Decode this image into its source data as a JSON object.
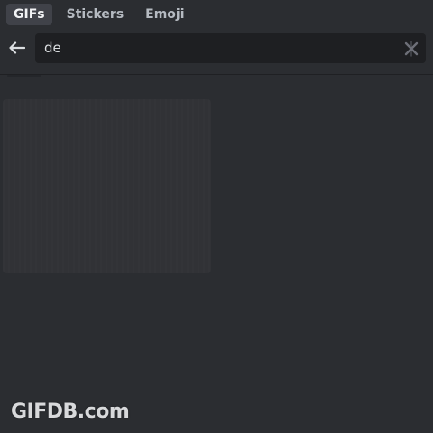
{
  "tabs": [
    {
      "label": "GIFs",
      "active": true
    },
    {
      "label": "Stickers",
      "active": false
    },
    {
      "label": "Emoji",
      "active": false
    }
  ],
  "search": {
    "value": "de",
    "back_icon": "arrow-left-icon",
    "clear_icon": "close-icon"
  },
  "results": {
    "loading_placeholders": 1
  },
  "watermark": "GIFDB.com",
  "colors": {
    "background": "#2b2d31",
    "input_background": "#1e1f22",
    "active_tab": "#404249",
    "text": "#dbdee1"
  }
}
